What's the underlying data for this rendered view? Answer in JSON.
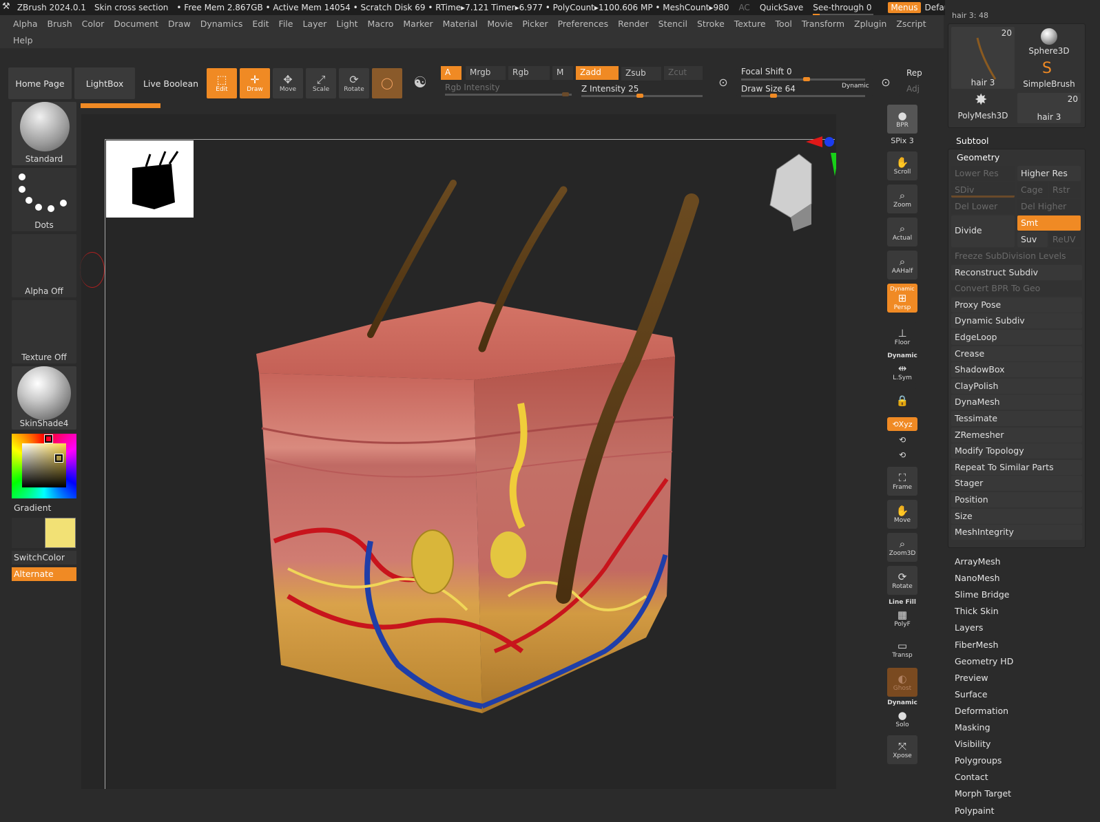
{
  "titlebar": {
    "app": "ZBrush 2024.0.1",
    "doc": "Skin cross section",
    "status": "• Free Mem 2.867GB • Active Mem 14054 • Scratch Disk 69 • RTime▸7.121 Timer▸6.977 • PolyCount▸1100.606 MP • MeshCount▸980",
    "ac": "AC",
    "quicksave": "QuickSave",
    "seethrough": "See-through  0",
    "menus": "Menus",
    "script": "DefaultZScript"
  },
  "menubar": {
    "row1": [
      "Alpha",
      "Brush",
      "Color",
      "Document",
      "Draw",
      "Dynamics",
      "Edit",
      "File",
      "Layer",
      "Light",
      "Macro",
      "Marker",
      "Material",
      "Movie",
      "Picker",
      "Preferences",
      "Render",
      "Stencil",
      "Stroke",
      "Texture",
      "Tool",
      "Transform",
      "Zplugin",
      "Zscript"
    ],
    "row2": [
      "Help"
    ]
  },
  "toolbar": {
    "home": "Home Page",
    "lightbox": "LightBox",
    "liveboolean": "Live Boolean",
    "edit": "Edit",
    "draw": "Draw",
    "move": "Move",
    "scale": "Scale",
    "rotate": "Rotate",
    "a": "A",
    "mrgb": "Mrgb",
    "rgb": "Rgb",
    "m": "M",
    "zadd": "Zadd",
    "zsub": "Zsub",
    "zcut": "Zcut",
    "rgb_intensity": "Rgb Intensity",
    "z_intensity": "Z Intensity 25",
    "focal_shift": "Focal Shift 0",
    "draw_size": "Draw Size 64",
    "dynamic": "Dynamic",
    "rep": "Rep",
    "adj": "Adj"
  },
  "leftshelf": {
    "brush": "Standard",
    "stroke": "Dots",
    "alpha": "Alpha Off",
    "texture": "Texture Off",
    "material": "SkinShade4",
    "gradient": "Gradient",
    "switchcolor": "SwitchColor",
    "alternate": "Alternate",
    "main_color": "#f2e175"
  },
  "rightcol": {
    "bpr": "BPR",
    "spix": "SPix 3",
    "scroll": "Scroll",
    "zoom": "Zoom",
    "actual": "Actual",
    "aahalf": "AAHalf",
    "dynamic": "Dynamic",
    "persp": "Persp",
    "floor": "Floor",
    "lsym": "L.Sym",
    "xyz": "⟲Xyz",
    "frame": "Frame",
    "move": "Move",
    "zoom3d": "Zoom3D",
    "rotate": "Rotate",
    "linefill": "Line Fill",
    "polyf": "PolyF",
    "transp": "Transp",
    "ghost": "Ghost",
    "solo": "Solo",
    "xpose": "Xpose"
  },
  "rightpanel": {
    "topslider": "hair 3: 48",
    "tiles": [
      {
        "label": "hair 3",
        "num": "20"
      },
      {
        "label": "Sphere3D",
        "num": ""
      },
      {
        "label": "PolyMesh3D",
        "num": ""
      },
      {
        "label": "SimpleBrush",
        "num": ""
      },
      {
        "label": "hair 3",
        "num": "20"
      }
    ],
    "subtool": "Subtool",
    "geometry": "Geometry",
    "lower_res": "Lower Res",
    "higher_res": "Higher Res",
    "sdiv": "SDiv",
    "cage": "Cage",
    "rstr": "Rstr",
    "del_lower": "Del Lower",
    "del_higher": "Del Higher",
    "divide": "Divide",
    "smt": "Smt",
    "suv": "Suv",
    "reuv": "ReUV",
    "geom_items": [
      {
        "label": "Freeze SubDivision Levels",
        "dim": true
      },
      {
        "label": "Reconstruct Subdiv",
        "dim": false
      },
      {
        "label": "Convert BPR To Geo",
        "dim": true
      },
      {
        "label": "Proxy Pose",
        "dim": false
      },
      {
        "label": "Dynamic Subdiv",
        "dim": false
      },
      {
        "label": "EdgeLoop",
        "dim": false
      },
      {
        "label": "Crease",
        "dim": false
      },
      {
        "label": "ShadowBox",
        "dim": false
      },
      {
        "label": "ClayPolish",
        "dim": false
      },
      {
        "label": "DynaMesh",
        "dim": false
      },
      {
        "label": "Tessimate",
        "dim": false
      },
      {
        "label": "ZRemesher",
        "dim": false
      },
      {
        "label": "Modify Topology",
        "dim": false
      },
      {
        "label": "Repeat To Similar Parts",
        "dim": false
      },
      {
        "label": "Stager",
        "dim": false
      },
      {
        "label": "Position",
        "dim": false
      },
      {
        "label": "Size",
        "dim": false
      },
      {
        "label": "MeshIntegrity",
        "dim": false
      }
    ],
    "tool_items": [
      "ArrayMesh",
      "NanoMesh",
      "Slime Bridge",
      "Thick Skin",
      "Layers",
      "FiberMesh",
      "Geometry HD",
      "Preview",
      "Surface",
      "Deformation",
      "Masking",
      "Visibility",
      "Polygroups",
      "Contact",
      "Morph Target",
      "Polypaint"
    ]
  }
}
